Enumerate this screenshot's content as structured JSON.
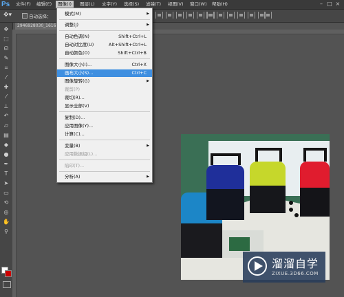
{
  "app": {
    "logo": "Ps"
  },
  "menubar": {
    "items": [
      "文件(F)",
      "编辑(E)",
      "图像(I)",
      "图层(L)",
      "文字(Y)",
      "选择(S)",
      "滤镜(T)",
      "视图(V)",
      "窗口(W)",
      "帮助(H)"
    ]
  },
  "options": {
    "auto_select_label": "自动选择："
  },
  "document": {
    "tab_title": "2946928030_1616"
  },
  "image_menu": {
    "items": [
      {
        "label": "模式(M)",
        "shortcut": "",
        "submenu": true,
        "disabled": false
      },
      {
        "label": "调整(J)",
        "shortcut": "",
        "submenu": true,
        "disabled": false
      },
      {
        "label": "自动色调(N)",
        "shortcut": "Shift+Ctrl+L",
        "submenu": false,
        "disabled": false
      },
      {
        "label": "自动对比度(U)",
        "shortcut": "Alt+Shift+Ctrl+L",
        "submenu": false,
        "disabled": false
      },
      {
        "label": "自动颜色(O)",
        "shortcut": "Shift+Ctrl+B",
        "submenu": false,
        "disabled": false
      },
      {
        "label": "图像大小(I)...",
        "shortcut": "Ctrl+X",
        "submenu": false,
        "disabled": false
      },
      {
        "label": "画布大小(S)...",
        "shortcut": "Ctrl+C",
        "submenu": false,
        "disabled": false,
        "highlight": true
      },
      {
        "label": "图像旋转(G)",
        "shortcut": "",
        "submenu": true,
        "disabled": false
      },
      {
        "label": "裁剪(P)",
        "shortcut": "",
        "submenu": false,
        "disabled": true
      },
      {
        "label": "裁切(R)...",
        "shortcut": "",
        "submenu": false,
        "disabled": false
      },
      {
        "label": "显示全部(V)",
        "shortcut": "",
        "submenu": false,
        "disabled": false
      },
      {
        "label": "复制(D)...",
        "shortcut": "",
        "submenu": false,
        "disabled": false
      },
      {
        "label": "应用图像(Y)...",
        "shortcut": "",
        "submenu": false,
        "disabled": false
      },
      {
        "label": "计算(C)...",
        "shortcut": "",
        "submenu": false,
        "disabled": false
      },
      {
        "label": "变量(B)",
        "shortcut": "",
        "submenu": true,
        "disabled": false
      },
      {
        "label": "应用数据组(L)...",
        "shortcut": "",
        "submenu": false,
        "disabled": true
      },
      {
        "label": "陷印(T)...",
        "shortcut": "",
        "submenu": false,
        "disabled": true
      },
      {
        "label": "分析(A)",
        "shortcut": "",
        "submenu": true,
        "disabled": false
      }
    ]
  },
  "watermark": {
    "title": "溜溜自学",
    "subtitle": "ZIXUE.3D66.COM"
  },
  "colors": {
    "menu_highlight": "#3f8fe0",
    "background_swatch": "#cc0000",
    "foreground_swatch": "#ffffff"
  }
}
